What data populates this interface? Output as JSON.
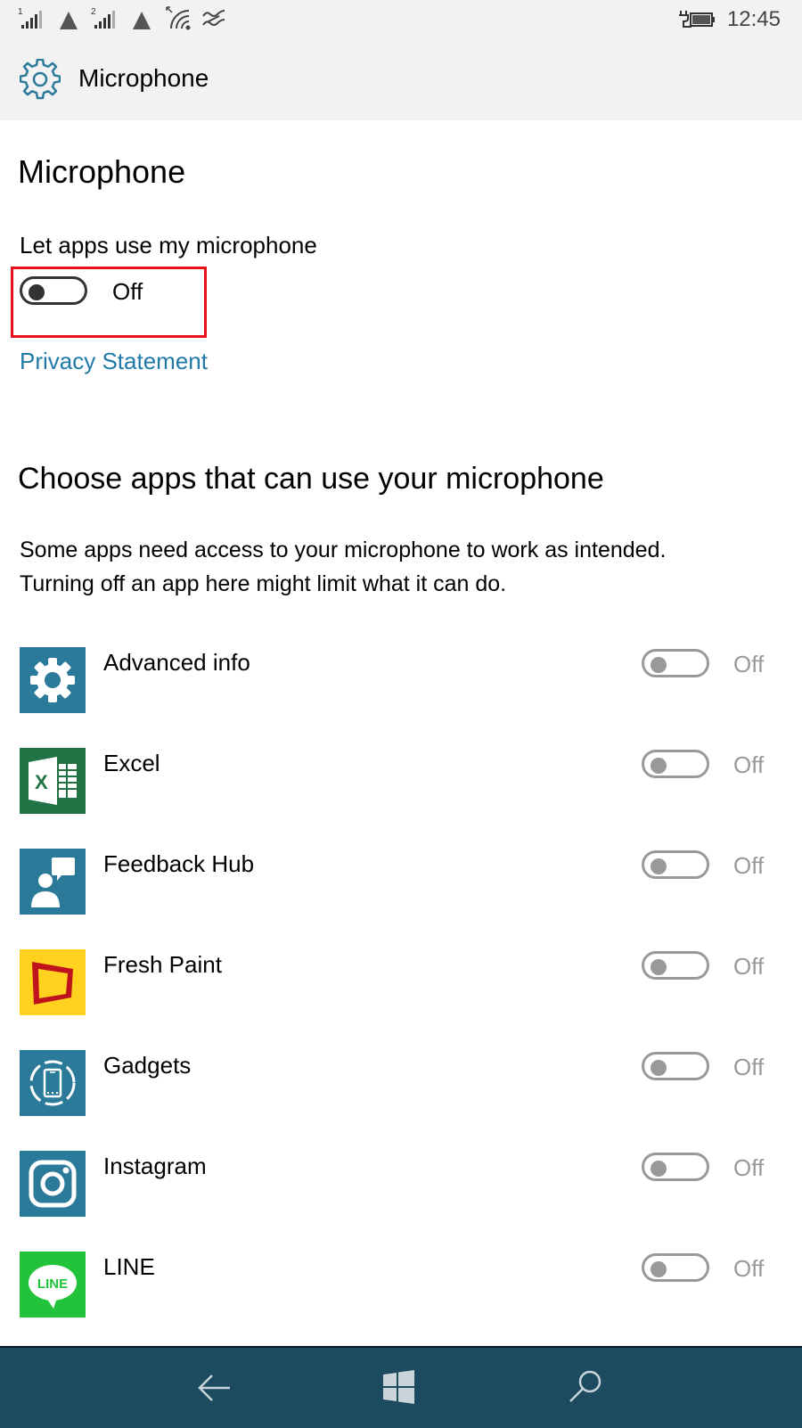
{
  "status_bar": {
    "sim1_label": "1",
    "sim2_label": "2",
    "time": "12:45",
    "icons": [
      "signal-sim1-icon",
      "data-triangle-icon",
      "signal-sim2-icon",
      "data-triangle-icon",
      "wifi-icon",
      "vibrate-icon",
      "battery-charging-icon"
    ]
  },
  "header": {
    "title": "Microphone",
    "icon": "gear-icon"
  },
  "main": {
    "page_title": "Microphone",
    "master_setting": {
      "label": "Let apps use my microphone",
      "state": "Off",
      "on": false
    },
    "privacy_link": "Privacy Statement",
    "section_title": "Choose apps that can use your microphone",
    "description_line1": "Some apps need access to your microphone to work as intended.",
    "description_line2": "Turning off an app here might limit what it can do.",
    "apps": [
      {
        "name": "Advanced info",
        "state": "Off",
        "on": false,
        "icon": "gear-icon",
        "tile_color": "#2b7a99"
      },
      {
        "name": "Excel",
        "state": "Off",
        "on": false,
        "icon": "excel-icon",
        "tile_color": "#217346"
      },
      {
        "name": "Feedback Hub",
        "state": "Off",
        "on": false,
        "icon": "feedback-person-icon",
        "tile_color": "#2b7a99"
      },
      {
        "name": "Fresh Paint",
        "state": "Off",
        "on": false,
        "icon": "canvas-frame-icon",
        "tile_color": "#ffd21f"
      },
      {
        "name": "Gadgets",
        "state": "Off",
        "on": false,
        "icon": "phone-circle-icon",
        "tile_color": "#2b7a99"
      },
      {
        "name": "Instagram",
        "state": "Off",
        "on": false,
        "icon": "camera-icon",
        "tile_color": "#2b7a99"
      },
      {
        "name": "LINE",
        "state": "Off",
        "on": false,
        "icon": "line-bubble-icon",
        "tile_color": "#22c33a",
        "icon_text": "LINE"
      }
    ]
  },
  "colors": {
    "accent": "#2179a8",
    "highlight": "#e8101a",
    "navbar": "#1c4a5e",
    "header_bg": "#f2f2f2"
  },
  "navbar": {
    "buttons": [
      "back-icon",
      "windows-start-icon",
      "search-icon"
    ]
  }
}
